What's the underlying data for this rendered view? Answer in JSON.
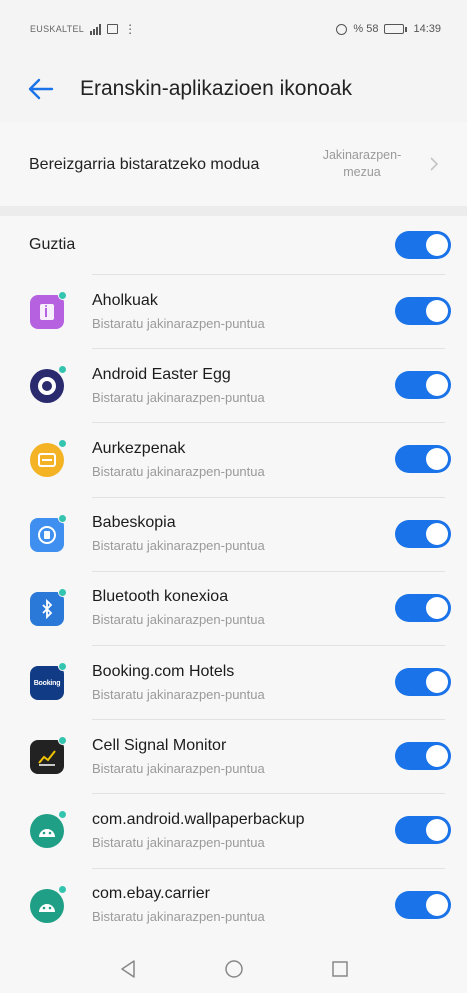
{
  "status_bar": {
    "carrier": "EUSKALTEL",
    "battery_text": "% 58",
    "battery_level": 0.58,
    "time": "14:39"
  },
  "app_bar": {
    "title": "Eranskin-aplikazioen ikonoak",
    "back_icon": "arrow-left-icon"
  },
  "mode_setting": {
    "label": "Bereizgarria bistaratzeko modua",
    "value": "Jakinarazpen-mezua",
    "chevron_icon": "chevron-right-icon"
  },
  "all_toggle": {
    "label": "Guztia",
    "enabled": true
  },
  "apps": [
    {
      "name": "Aholkuak",
      "subtitle": "Bistaratu jakinarazpen-puntua",
      "enabled": true,
      "icon": "tips-icon",
      "icon_color": "#b561e0"
    },
    {
      "name": "Android Easter Egg",
      "subtitle": "Bistaratu jakinarazpen-puntua",
      "enabled": true,
      "icon": "easter-egg-icon",
      "icon_color": "#2a2a6e"
    },
    {
      "name": "Aurkezpenak",
      "subtitle": "Bistaratu jakinarazpen-puntua",
      "enabled": true,
      "icon": "presentation-icon",
      "icon_color": "#f3b325"
    },
    {
      "name": "Babeskopia",
      "subtitle": "Bistaratu jakinarazpen-puntua",
      "enabled": true,
      "icon": "backup-icon",
      "icon_color": "#3e8ff0"
    },
    {
      "name": "Bluetooth konexioa",
      "subtitle": "Bistaratu jakinarazpen-puntua",
      "enabled": true,
      "icon": "bluetooth-icon",
      "icon_color": "#2a78d8"
    },
    {
      "name": "Booking.com Hotels",
      "subtitle": "Bistaratu jakinarazpen-puntua",
      "enabled": true,
      "icon": "booking-icon",
      "icon_color": "#123b85",
      "icon_text": "Booking"
    },
    {
      "name": "Cell Signal Monitor",
      "subtitle": "Bistaratu jakinarazpen-puntua",
      "enabled": true,
      "icon": "signal-chart-icon",
      "icon_color": "#222222"
    },
    {
      "name": "com.android.wallpaperbackup",
      "subtitle": "Bistaratu jakinarazpen-puntua",
      "enabled": true,
      "icon": "android-icon",
      "icon_color": "#1f9f85"
    },
    {
      "name": "com.ebay.carrier",
      "subtitle": "Bistaratu jakinarazpen-puntua",
      "enabled": true,
      "icon": "android-icon",
      "icon_color": "#1f9f85"
    }
  ],
  "colors": {
    "accent": "#1a73e8",
    "notification_dot": "#34c5b0"
  },
  "nav_bar": {
    "back_icon": "triangle-back-icon",
    "home_icon": "circle-home-icon",
    "recents_icon": "square-recents-icon"
  }
}
